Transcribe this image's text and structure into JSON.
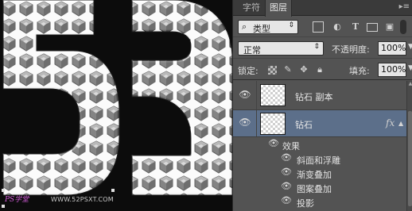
{
  "panel": {
    "tabs": [
      "字符",
      "图层"
    ],
    "active_tab": "图层",
    "menu_icon": "panel-menu-icon"
  },
  "filter": {
    "label": "类型",
    "icons": [
      "image-filter-icon",
      "adjustment-filter-icon",
      "type-filter-icon",
      "shape-filter-icon",
      "smart-object-filter-icon"
    ]
  },
  "blend": {
    "mode": "正常",
    "opacity_label": "不透明度:",
    "opacity_value": "100%"
  },
  "lock": {
    "label": "锁定:",
    "fill_label": "填充:",
    "fill_value": "100%"
  },
  "layers": [
    {
      "name": "钻石 副本",
      "visible": true,
      "selected": false
    },
    {
      "name": "钻石",
      "visible": true,
      "selected": true,
      "fx": "fx",
      "effects_label": "效果",
      "effects": [
        "斜面和浮雕",
        "渐变叠加",
        "图案叠加",
        "投影"
      ]
    }
  ],
  "watermark": {
    "left": "PS学堂",
    "right": "WWW.52PSXT.COM"
  },
  "colors": {
    "panel_bg": "#535353",
    "selected_layer": "#5c6f8a",
    "canvas_bg": "#0c0c0c"
  }
}
